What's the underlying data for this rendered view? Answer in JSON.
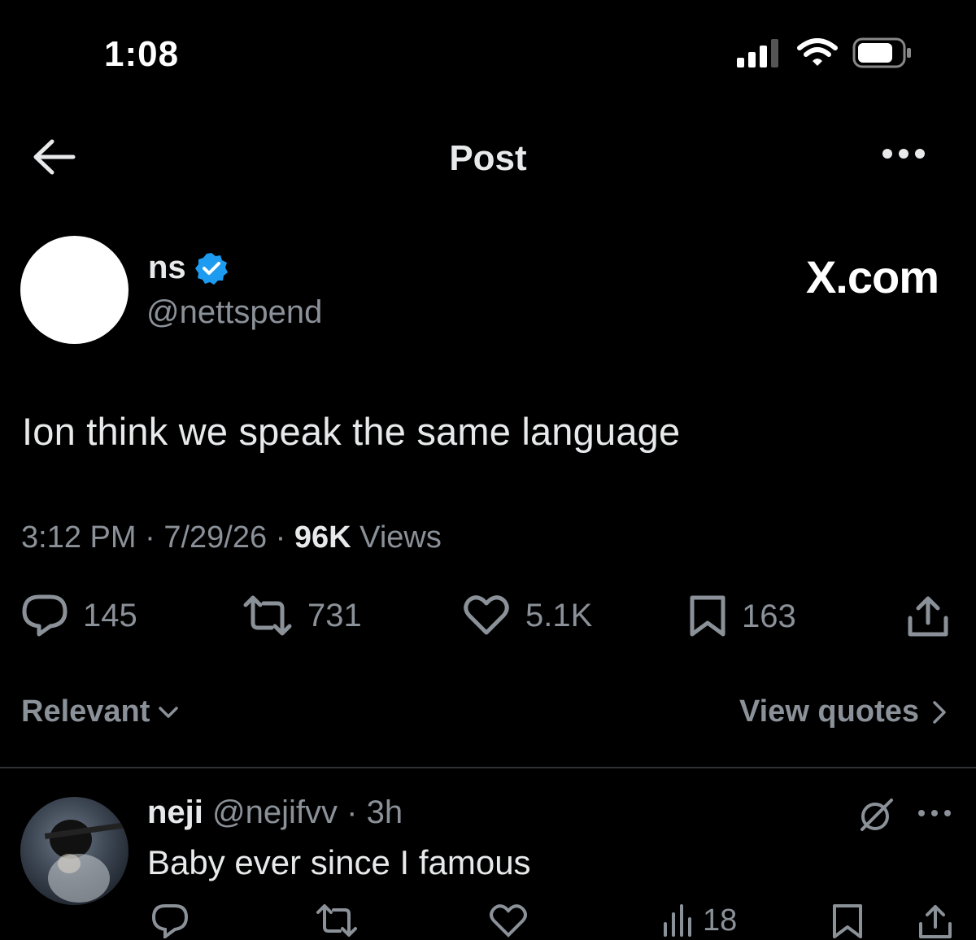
{
  "status_bar": {
    "time": "1:08"
  },
  "header": {
    "title": "Post"
  },
  "post": {
    "author_name": "ns",
    "author_handle": "@nettspend",
    "watermark": "X.com",
    "text": "Ion think we speak the same language",
    "time": "3:12 PM",
    "date": "7/29/26",
    "sep": "·",
    "views_count": "96K",
    "views_label": "Views",
    "replies": "145",
    "reposts": "731",
    "likes": "5.1K",
    "bookmarks": "163"
  },
  "sort": {
    "label": "Relevant",
    "view_quotes": "View quotes"
  },
  "reply": {
    "name": "neji",
    "handle": "@nejifvv",
    "sep": "·",
    "age": "3h",
    "text": "Baby ever since I famous",
    "views": "18"
  },
  "colors": {
    "background": "#000000",
    "text": "#e7e9ea",
    "muted": "#8b9198",
    "verified": "#1d9bf0"
  }
}
